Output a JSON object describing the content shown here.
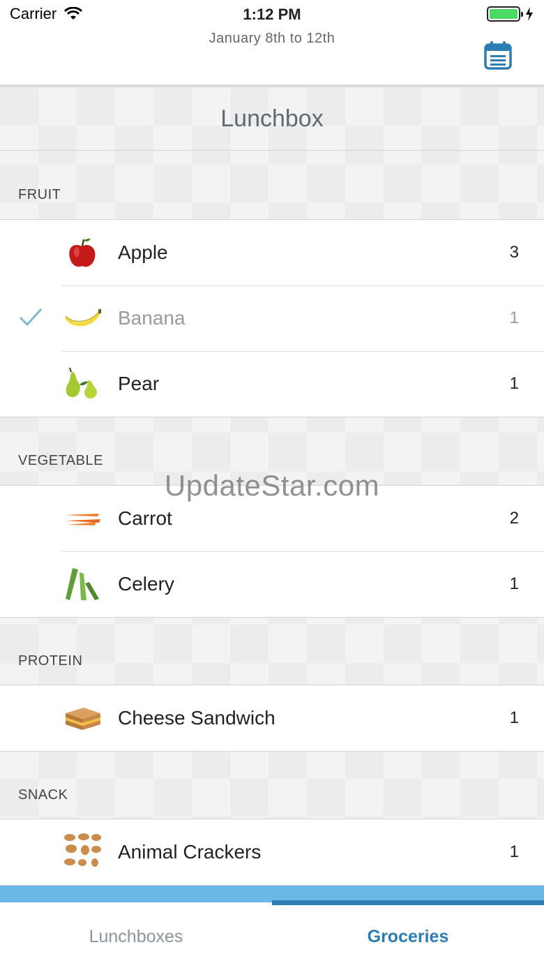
{
  "status_bar": {
    "carrier": "Carrier",
    "time": "1:12 PM"
  },
  "header": {
    "date_range": "January 8th to 12th",
    "calendar_icon": "calendar-list-icon"
  },
  "lunchbox": {
    "title": "Lunchbox"
  },
  "sections": [
    {
      "name": "FRUIT",
      "items": [
        {
          "name": "Apple",
          "qty": "3",
          "checked": false,
          "icon": "apple-icon"
        },
        {
          "name": "Banana",
          "qty": "1",
          "checked": true,
          "icon": "banana-icon"
        },
        {
          "name": "Pear",
          "qty": "1",
          "checked": false,
          "icon": "pear-icon"
        }
      ]
    },
    {
      "name": "VEGETABLE",
      "items": [
        {
          "name": "Carrot",
          "qty": "2",
          "checked": false,
          "icon": "carrot-icon"
        },
        {
          "name": "Celery",
          "qty": "1",
          "checked": false,
          "icon": "celery-icon"
        }
      ]
    },
    {
      "name": "PROTEIN",
      "items": [
        {
          "name": "Cheese Sandwich",
          "qty": "1",
          "checked": false,
          "icon": "sandwich-icon"
        }
      ]
    },
    {
      "name": "SNACK",
      "items": [
        {
          "name": "Animal Crackers",
          "qty": "1",
          "checked": false,
          "icon": "crackers-icon"
        }
      ]
    }
  ],
  "watermark": "UpdateStar.com",
  "tabs": [
    {
      "label": "Lunchboxes",
      "active": false
    },
    {
      "label": "Groceries",
      "active": true
    }
  ],
  "colors": {
    "accent": "#2b7db4",
    "tab_strip": "#6bb8e6",
    "check": "#7fb6d3",
    "battery": "#4cd964"
  }
}
